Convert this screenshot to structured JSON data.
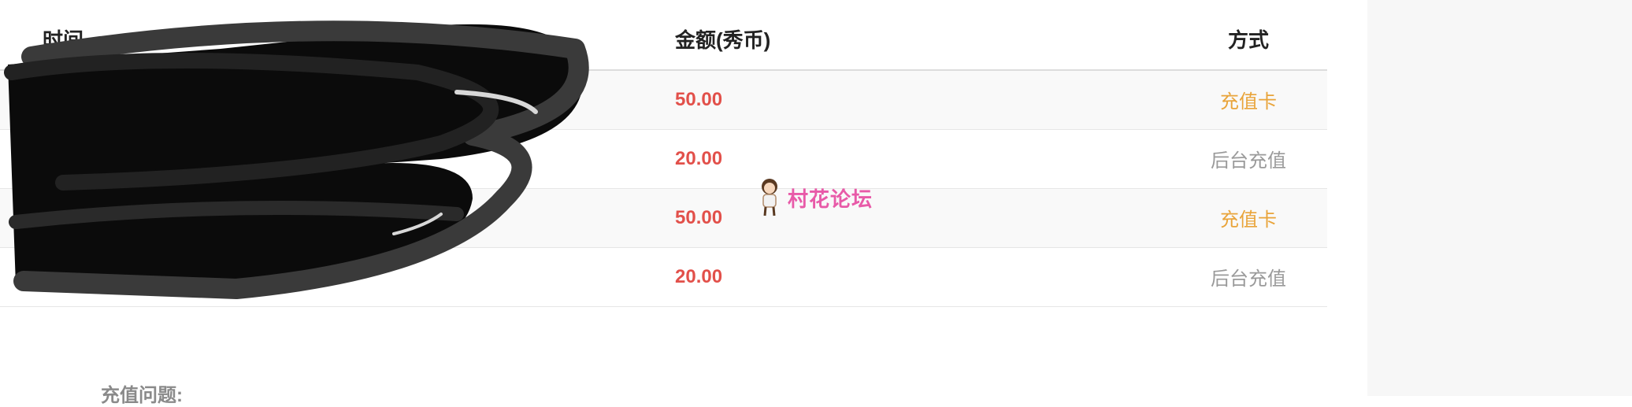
{
  "table": {
    "headers": {
      "time": "时间",
      "amount": "金额(秀币)",
      "method": "方式"
    },
    "rows": [
      {
        "amount": "50.00",
        "method": "充值卡"
      },
      {
        "amount": "20.00",
        "method": "后台充值"
      },
      {
        "amount": "50.00",
        "method": "充值卡"
      },
      {
        "amount": "20.00",
        "method": "后台充值"
      }
    ]
  },
  "watermark": {
    "text": "村花论坛",
    "icon": "girl-mascot-icon"
  },
  "faq": {
    "heading": "充值问题:"
  },
  "colors": {
    "amount": "#e2504a",
    "card_method": "#e9a43a",
    "admin_method": "#9a9a9a",
    "watermark": "#e85aa8",
    "side_panel": "#f7f7f7"
  }
}
